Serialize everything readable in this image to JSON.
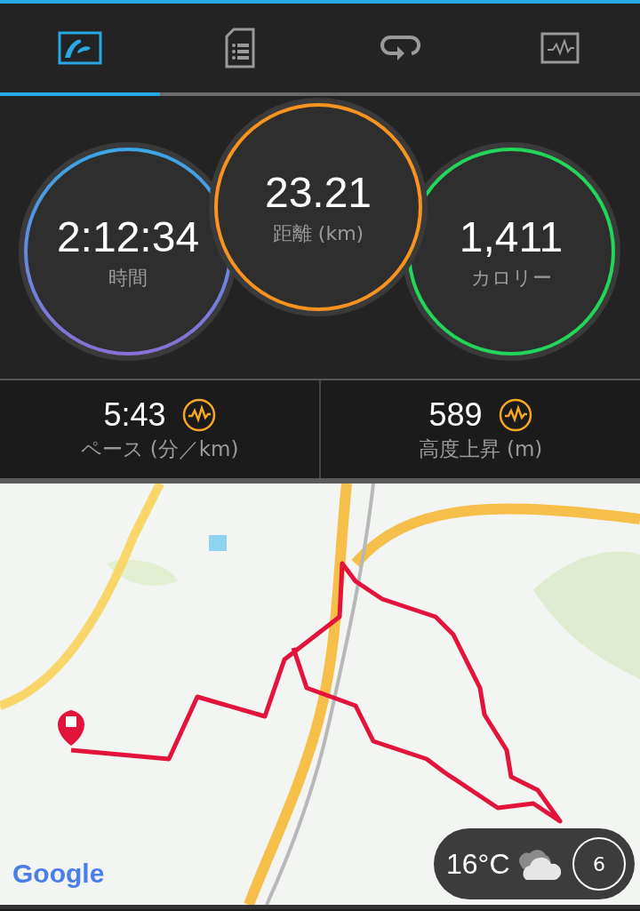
{
  "tabs": [
    {
      "kind": "map",
      "selected": true
    },
    {
      "kind": "details",
      "selected": false
    },
    {
      "kind": "laps",
      "selected": false
    },
    {
      "kind": "chart",
      "selected": false
    }
  ],
  "summary": [
    {
      "value": "2:12:34",
      "label": "時間",
      "color": "#3aa7e6"
    },
    {
      "value": "23.21",
      "label": "距離 (km)",
      "color": "#f7931e"
    },
    {
      "value": "1,411",
      "label": "カロリー",
      "color": "#22d65a"
    }
  ],
  "metrics": [
    {
      "value": "5:43",
      "label": "ペース (分／km)"
    },
    {
      "value": "589",
      "label": "高度上昇 (m)"
    }
  ],
  "map": {
    "attribution": "Google",
    "weather": {
      "temperature": "16°C",
      "dial": "6"
    }
  }
}
